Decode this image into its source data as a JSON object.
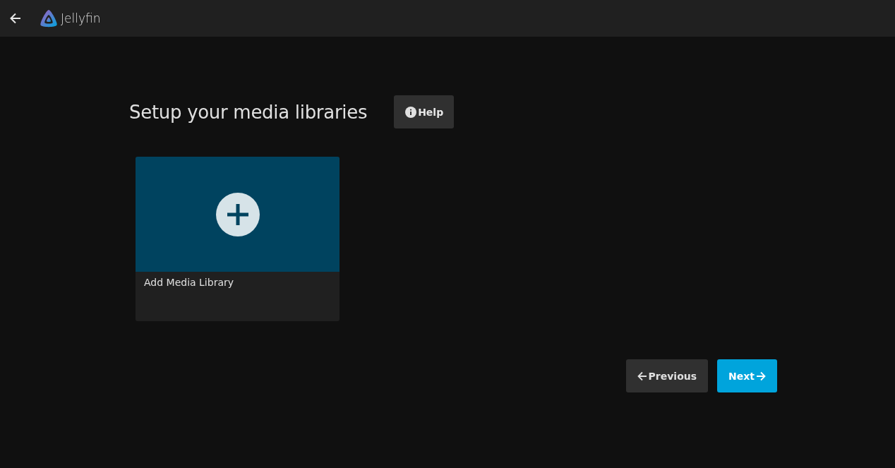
{
  "header": {
    "app_name": "Jellyfin"
  },
  "page": {
    "title": "Setup your media libraries",
    "help_button": "Help"
  },
  "libraries": [
    {
      "kind": "add",
      "label": "Add Media Library"
    }
  ],
  "buttons": [
    {
      "kind": "secondary",
      "label": "Previous"
    },
    {
      "kind": "primary",
      "label": "Next"
    }
  ]
}
